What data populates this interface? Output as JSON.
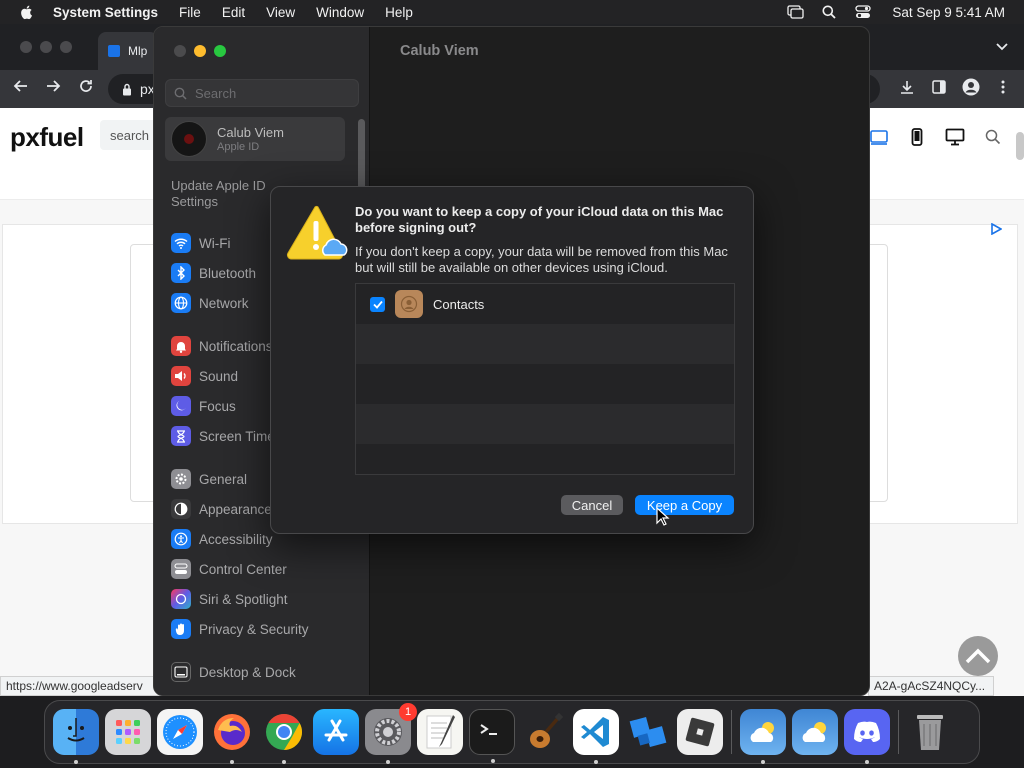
{
  "menubar": {
    "app_name": "System Settings",
    "menus": [
      "File",
      "Edit",
      "View",
      "Window",
      "Help"
    ],
    "clock": "Sat Sep 9  5:41 AM"
  },
  "browser": {
    "tab_label": "Mlp",
    "url_prefix": "px",
    "site_logo": "pxfuel",
    "site_search_placeholder": "search",
    "status_url_left": "https://www.googleadserv",
    "status_url_right": "A2A-gAcSZ4NQCy..."
  },
  "settings": {
    "search_placeholder": "Search",
    "account_name": "Calub Viem",
    "account_sub": "Apple ID",
    "update_text": "Update Apple ID Settings",
    "main_title": "Calub Viem",
    "items": [
      {
        "label": "Wi-Fi",
        "color": "#1a7cf5",
        "icon": "wifi-icon"
      },
      {
        "label": "Bluetooth",
        "color": "#1a7cf5",
        "icon": "bluetooth-icon"
      },
      {
        "label": "Network",
        "color": "#1a7cf5",
        "icon": "globe-icon"
      },
      {
        "label": "Notifications",
        "color": "#e0443e",
        "icon": "bell-icon"
      },
      {
        "label": "Sound",
        "color": "#e0443e",
        "icon": "speaker-icon"
      },
      {
        "label": "Focus",
        "color": "#5e5ce6",
        "icon": "moon-icon"
      },
      {
        "label": "Screen Time",
        "color": "#5e5ce6",
        "icon": "hourglass-icon"
      },
      {
        "label": "General",
        "color": "#8e8e93",
        "icon": "gear-icon"
      },
      {
        "label": "Appearance",
        "color": "#3a3a3c",
        "icon": "appearance-icon"
      },
      {
        "label": "Accessibility",
        "color": "#1a7cf5",
        "icon": "accessibility-icon"
      },
      {
        "label": "Control Center",
        "color": "#8e8e93",
        "icon": "control-center-icon"
      },
      {
        "label": "Siri & Spotlight",
        "color": "#b54dd8",
        "icon": "siri-icon"
      },
      {
        "label": "Privacy & Security",
        "color": "#1a7cf5",
        "icon": "hand-icon"
      },
      {
        "label": "Desktop & Dock",
        "color": "#2c2c2e",
        "icon": "dock-icon"
      }
    ]
  },
  "dialog": {
    "title": "Do you want to keep a copy of your iCloud data on this Mac before signing out?",
    "body": "If you don't keep a copy, your data will be removed from this Mac but will still be available on other devices using iCloud.",
    "items": [
      {
        "label": "Contacts",
        "checked": true
      }
    ],
    "cancel_label": "Cancel",
    "keep_label": "Keep a Copy"
  },
  "dock": {
    "apps": [
      "Finder",
      "Launchpad",
      "Safari",
      "Firefox",
      "Chrome",
      "App Store",
      "System Settings",
      "TextEdit",
      "Terminal",
      "GarageBand",
      "Visual Studio Code",
      "Roblox Studio",
      "Roblox",
      "Weather",
      "Weather",
      "Discord",
      "Trash"
    ],
    "settings_badge": "1"
  }
}
